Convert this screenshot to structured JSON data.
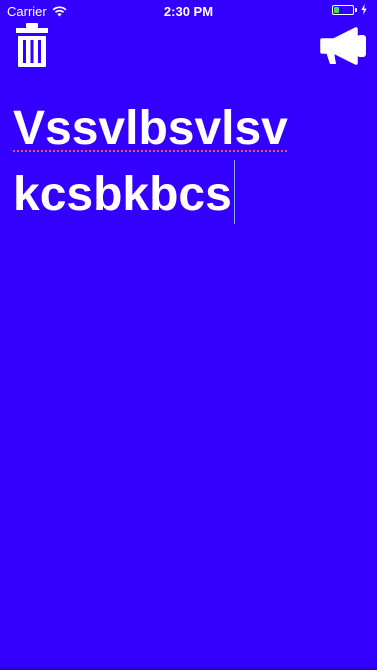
{
  "status_bar": {
    "carrier": "Carrier",
    "time": "2:30 PM",
    "battery_level": 0.3,
    "battery_color": "#4cd964",
    "wifi_icon": "wifi-icon",
    "battery_icon": "battery-icon",
    "charging_icon": "charging-bolt-icon"
  },
  "toolbar": {
    "delete_icon": "trash-icon",
    "speak_icon": "megaphone-icon"
  },
  "note": {
    "line1": "Vssvlbsvlsv",
    "line2": "kcsbkbcs"
  },
  "theme": {
    "background": "#3300ff",
    "text": "#ffffff"
  }
}
